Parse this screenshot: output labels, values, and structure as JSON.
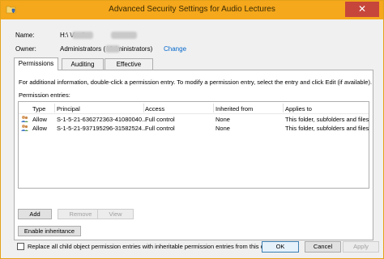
{
  "window": {
    "title": "Advanced Security Settings for Audio Lectures",
    "close_glyph": "✕",
    "accent_color": "#f5a81c"
  },
  "fields": {
    "name_label": "Name:",
    "name_value": "H:\\           \\Audio",
    "owner_label": "Owner:",
    "owner_value": "Administrators (        \\Administrators)",
    "change_link": "Change"
  },
  "tabs": [
    {
      "label": "Permissions"
    },
    {
      "label": "Auditing"
    },
    {
      "label": "Effective Access"
    }
  ],
  "panel": {
    "info_text": "For additional information, double-click a permission entry. To modify a permission entry, select the entry and click Edit (if available).",
    "entries_label": "Permission entries:"
  },
  "table": {
    "columns": [
      "Type",
      "Principal",
      "Access",
      "Inherited from",
      "Applies to"
    ],
    "rows": [
      {
        "type": "Allow",
        "principal": "S-1-5-21-636272363-41080040...",
        "access": "Full control",
        "inherited": "None",
        "applies": "This folder, subfolders and files"
      },
      {
        "type": "Allow",
        "principal": "S-1-5-21-937195296-31582524...",
        "access": "Full control",
        "inherited": "None",
        "applies": "This folder, subfolders and files"
      }
    ]
  },
  "buttons": {
    "add": "Add",
    "remove": "Remove",
    "view": "View",
    "enable_inheritance": "Enable inheritance",
    "ok": "OK",
    "cancel": "Cancel",
    "apply": "Apply"
  },
  "replace_option": "Replace all child object permission entries with inheritable permission entries from this object",
  "icons": {
    "title": "folder-shield-icon",
    "user": "users-icon"
  }
}
